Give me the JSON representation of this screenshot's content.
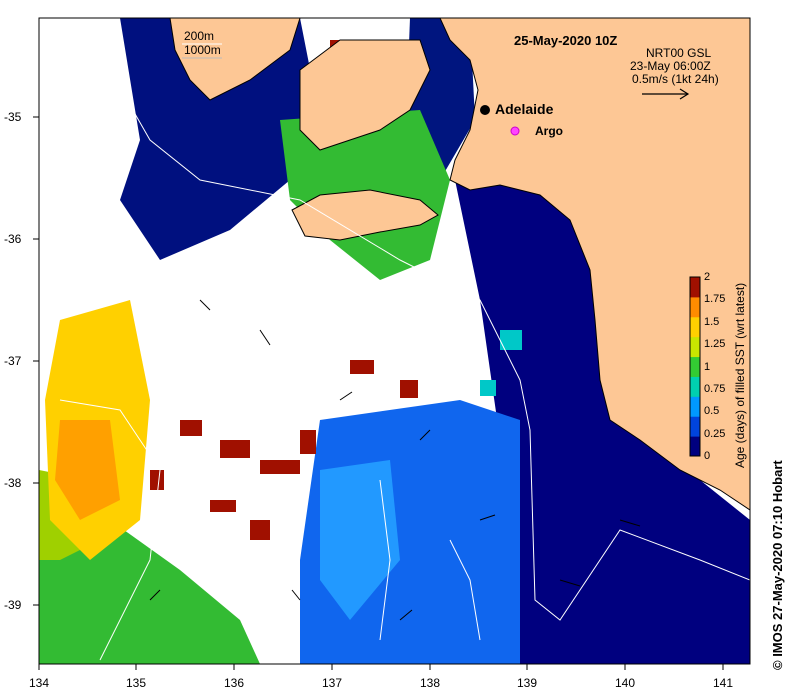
{
  "header": {
    "date": "25-May-2020 10Z",
    "altimetry": "NRT00 GSL",
    "altimetry_time": "23-May 06:00Z",
    "vector_scale": "0.5m/s (1kt 24h)"
  },
  "isobaths": {
    "shallow": "200m",
    "deep": "1000m"
  },
  "markers": {
    "city": "Adelaide",
    "float": "Argo"
  },
  "axes": {
    "x_ticks": [
      "134",
      "135",
      "136",
      "137",
      "138",
      "139",
      "140",
      "141"
    ],
    "y_ticks": [
      "-35",
      "-36",
      "-37",
      "-38",
      "-39"
    ]
  },
  "colorbar": {
    "label": "Age (days) of filled SST (wrt latest)",
    "ticks": [
      "2",
      "1.75",
      "1.5",
      "1.25",
      "1",
      "0.75",
      "0.5",
      "0.25",
      "0"
    ],
    "colors": [
      "#00007f",
      "#0044dd",
      "#0099ff",
      "#00d0b0",
      "#33cc33",
      "#c8e600",
      "#ffd000",
      "#ff8c00",
      "#a01000"
    ]
  },
  "credit": "© IMOS 27-May-2020 07:10 Hobart",
  "colors": {
    "land": "#fdc795",
    "nodata": "#ffffff",
    "coast": "#000000"
  }
}
